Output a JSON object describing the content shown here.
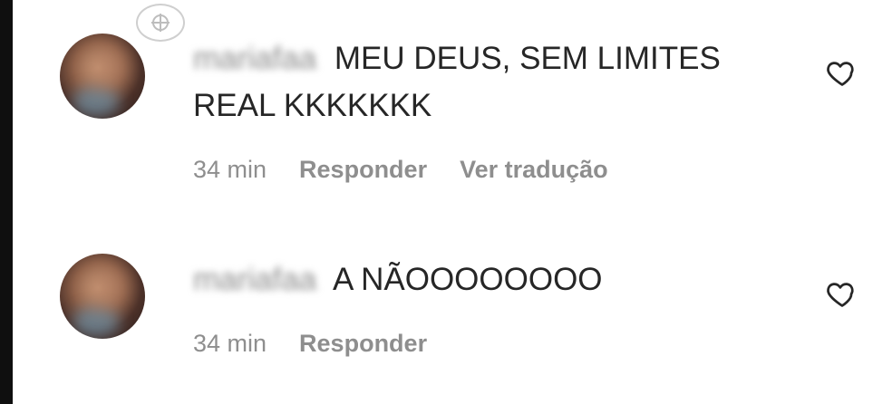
{
  "comments": [
    {
      "username": "mariafaa",
      "text": "MEU DEUS, SEM LIMITES REAL KKKKKKK",
      "time": "34 min",
      "reply_label": "Responder",
      "translate_label": "Ver tradução"
    },
    {
      "username": "mariafaa",
      "text": "A NÃOOOOOOOO",
      "time": "34 min",
      "reply_label": "Responder"
    }
  ],
  "icons": {
    "drag": "drag-handle-icon",
    "like": "heart-icon"
  },
  "colors": {
    "text": "#262626",
    "meta": "#8e8e8e",
    "divider": "#0f0f0f"
  }
}
